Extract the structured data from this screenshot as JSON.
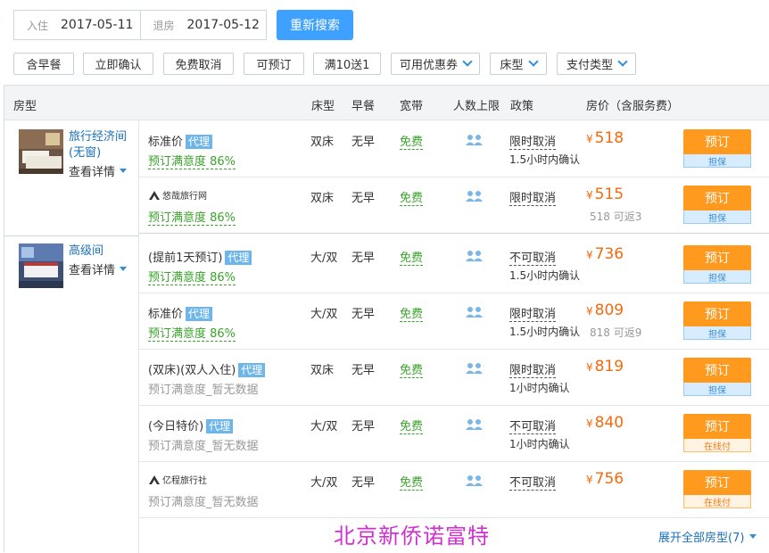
{
  "search": {
    "checkin_label": "入住",
    "checkin_value": "2017-05-11",
    "checkout_label": "退房",
    "checkout_value": "2017-05-12",
    "button": "重新搜索"
  },
  "filters": [
    "含早餐",
    "立即确认",
    "免费取消",
    "可预订",
    "满10送1",
    "可用优惠券",
    "床型",
    "支付类型"
  ],
  "table": {
    "headers": {
      "room": "房型",
      "bed": "床型",
      "breakfast": "早餐",
      "broadband": "宽带",
      "capacity": "人数上限",
      "policy": "政策",
      "price": "房价（含服务费）"
    }
  },
  "rooms": [
    {
      "name": "旅行经济间(无窗)",
      "detail": "查看详情",
      "offers": [
        {
          "title": "标准价",
          "agent": "代理",
          "satisfaction": "预订满意度 86%",
          "bed": "双床",
          "breakfast": "无早",
          "broadband": "免费",
          "policy": "限时取消",
          "confirm": "1.5小时内确认",
          "price": "518",
          "cashback": "",
          "book": "预订",
          "badge": "担保",
          "badge_type": "blue"
        },
        {
          "title": "",
          "logo": "悠哉旅行网",
          "satisfaction": "预订满意度 86%",
          "bed": "双床",
          "breakfast": "无早",
          "broadband": "免费",
          "policy": "限时取消",
          "confirm": "",
          "price": "515",
          "cashback": "518 可返3",
          "book": "预订",
          "badge": "担保",
          "badge_type": "blue"
        }
      ]
    },
    {
      "name": "高级间",
      "detail": "查看详情",
      "offers": [
        {
          "title": "(提前1天预订)",
          "agent": "代理",
          "satisfaction": "预订满意度 86%",
          "bed": "大/双",
          "breakfast": "无早",
          "broadband": "免费",
          "policy": "不可取消",
          "confirm": "1.5小时内确认",
          "price": "736",
          "cashback": "",
          "book": "预订",
          "badge": "担保",
          "badge_type": "blue"
        },
        {
          "title": "标准价",
          "agent": "代理",
          "satisfaction": "预订满意度 86%",
          "bed": "大/双",
          "breakfast": "无早",
          "broadband": "免费",
          "policy": "限时取消",
          "confirm": "1.5小时内确认",
          "price": "809",
          "cashback": "818 可返9",
          "book": "预订",
          "badge": "担保",
          "badge_type": "blue"
        },
        {
          "title": "(双床)(双人入住)",
          "agent": "代理",
          "nodata": "预订满意度_暂无数据",
          "bed": "双床",
          "breakfast": "无早",
          "broadband": "免费",
          "policy": "限时取消",
          "confirm": "1小时内确认",
          "price": "819",
          "cashback": "",
          "book": "预订",
          "badge": "担保",
          "badge_type": "blue"
        },
        {
          "title": "(今日特价)",
          "agent": "代理",
          "nodata": "预订满意度_暂无数据",
          "bed": "大/双",
          "breakfast": "无早",
          "broadband": "免费",
          "policy": "不可取消",
          "confirm": "1小时内确认",
          "price": "840",
          "cashback": "",
          "book": "预订",
          "badge": "在线付",
          "badge_type": "orange"
        },
        {
          "title": "",
          "logo": "亿程旅行社",
          "nodata": "预订满意度_暂无数据",
          "bed": "大/双",
          "breakfast": "无早",
          "broadband": "免费",
          "policy": "不可取消",
          "confirm": "",
          "price": "756",
          "cashback": "",
          "book": "预订",
          "badge": "在线付",
          "badge_type": "orange"
        }
      ]
    }
  ],
  "currency": "¥",
  "watermark": "北京新侨诺富特",
  "expand_all": "展开全部房型(7)",
  "colors": {
    "accent": "#3ea0ff",
    "book": "#ff9a1f",
    "price": "#f26a0e",
    "green": "#3aa32a",
    "link": "#1a6fb8"
  },
  "icons": {
    "people": "two-person-icon",
    "caret": "chevron-down-icon"
  }
}
